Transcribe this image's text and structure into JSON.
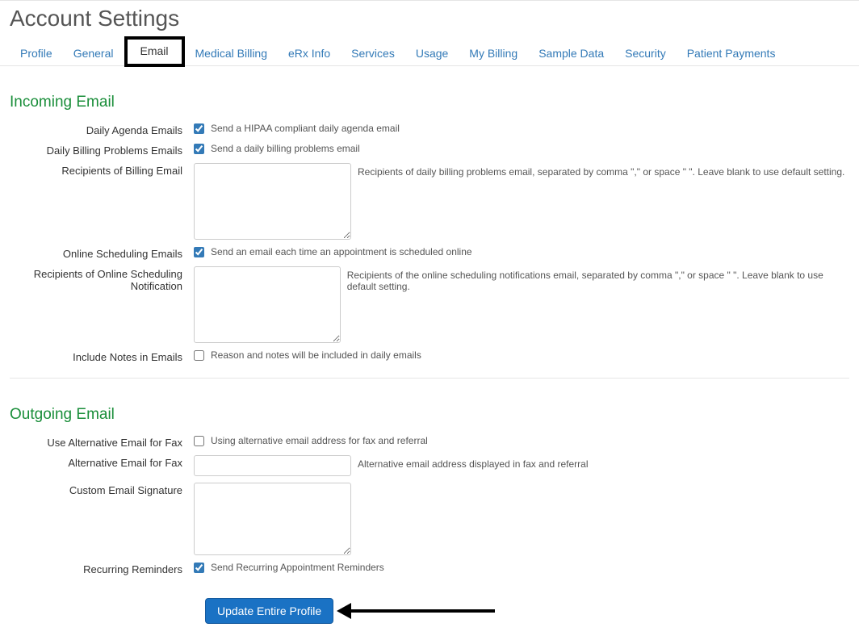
{
  "pageTitle": "Account Settings",
  "tabs": {
    "profile": "Profile",
    "general": "General",
    "email": "Email",
    "medicalBilling": "Medical Billing",
    "erxInfo": "eRx Info",
    "services": "Services",
    "usage": "Usage",
    "myBilling": "My Billing",
    "sampleData": "Sample Data",
    "security": "Security",
    "patientPayments": "Patient Payments"
  },
  "sections": {
    "incoming": {
      "title": "Incoming Email",
      "dailyAgenda": {
        "label": "Daily Agenda Emails",
        "checked": true,
        "text": "Send a HIPAA compliant daily agenda email"
      },
      "dailyBilling": {
        "label": "Daily Billing Problems Emails",
        "checked": true,
        "text": "Send a daily billing problems email"
      },
      "recipientsBilling": {
        "label": "Recipients of Billing Email",
        "value": "",
        "help": "Recipients of daily billing problems email, separated by comma \",\" or space \" \". Leave blank to use default setting."
      },
      "onlineScheduling": {
        "label": "Online Scheduling Emails",
        "checked": true,
        "text": "Send an email each time an appointment is scheduled online"
      },
      "recipientsOnlineScheduling": {
        "label": "Recipients of Online Scheduling Notification",
        "value": "",
        "help": "Recipients of the online scheduling notifications email, separated by comma \",\" or space \" \". Leave blank to use default setting."
      },
      "includeNotes": {
        "label": "Include Notes in Emails",
        "checked": false,
        "text": "Reason and notes will be included in daily emails"
      }
    },
    "outgoing": {
      "title": "Outgoing Email",
      "useAltEmailFax": {
        "label": "Use Alternative Email for Fax",
        "checked": false,
        "text": "Using alternative email address for fax and referral"
      },
      "altEmailFax": {
        "label": "Alternative Email for Fax",
        "value": "",
        "help": "Alternative email address displayed in fax and referral"
      },
      "customSignature": {
        "label": "Custom Email Signature",
        "value": ""
      },
      "recurringReminders": {
        "label": "Recurring Reminders",
        "checked": true,
        "text": "Send Recurring Appointment Reminders"
      }
    }
  },
  "actions": {
    "updateProfile": "Update Entire Profile"
  }
}
